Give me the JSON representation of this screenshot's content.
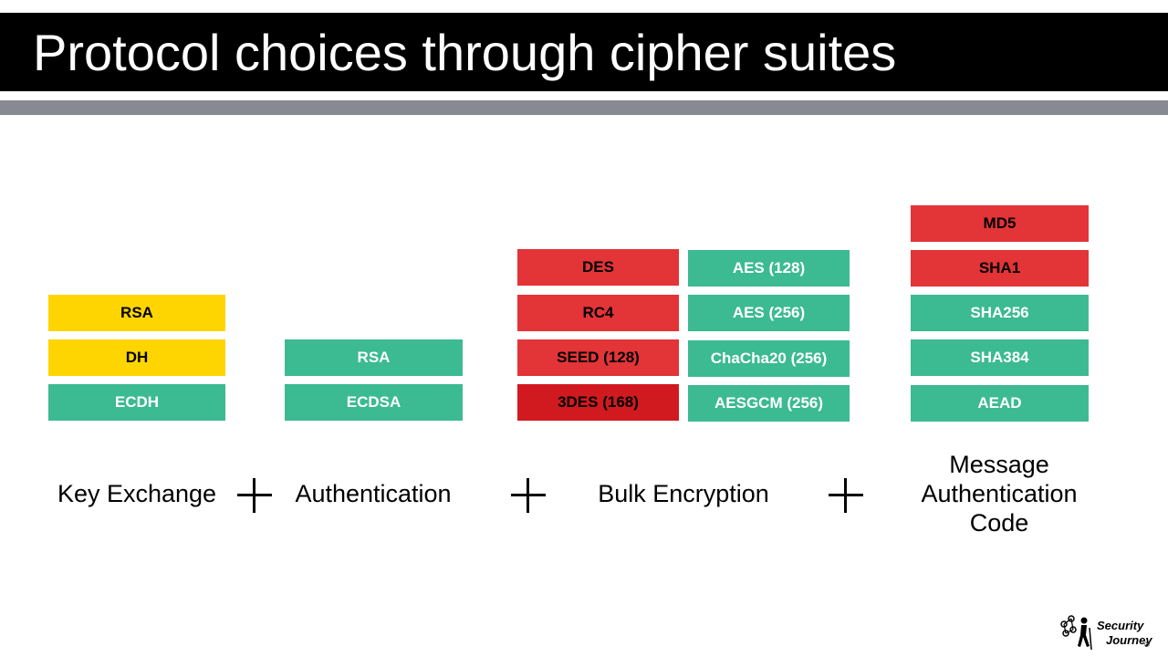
{
  "title": "Protocol choices through cipher suites",
  "key_exchange": {
    "label": "Key Exchange",
    "items": [
      "RSA",
      "DH",
      "ECDH"
    ]
  },
  "authentication": {
    "label": "Authentication",
    "items": [
      "RSA",
      "ECDSA"
    ]
  },
  "bulk_encryption": {
    "label": "Bulk Encryption",
    "weak": [
      "DES",
      "RC4",
      "SEED (128)",
      "3DES (168)"
    ],
    "strong": [
      "AES (128)",
      "AES (256)",
      "ChaCha20 (256)",
      "AESGCM (256)"
    ]
  },
  "mac": {
    "label_lines": [
      "Message",
      "Authentication",
      "Code"
    ],
    "items": [
      "MD5",
      "SHA1",
      "SHA256",
      "SHA384",
      "AEAD"
    ]
  },
  "operators": {
    "plus": "+"
  },
  "logo": {
    "line1": "Security",
    "line2": "Journey",
    "reg": "®"
  },
  "colors": {
    "yellow": "#ffd500",
    "green": "#3cba92",
    "red": "#e33437",
    "dark_red": "#d11a1f",
    "title_bar": "#000000",
    "divider": "#878a93"
  }
}
